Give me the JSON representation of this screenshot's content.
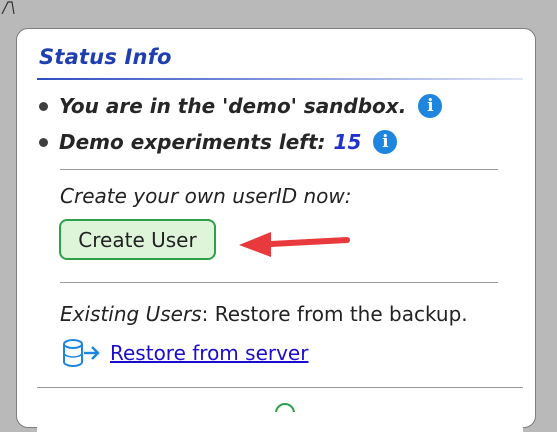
{
  "panel": {
    "title": "Status Info",
    "sandbox_line": "You are in the 'demo' sandbox.",
    "experiments_label": "Demo experiments left:",
    "experiments_count": "15",
    "info_icon_glyph": "i",
    "create_prompt": "Create your own userID now:",
    "create_button_label": "Create User",
    "existing_users_label": "Existing Users",
    "existing_users_text": ": Restore from the backup.",
    "restore_link_label": "Restore from server",
    "icons": [
      "info-icon",
      "database-restore-icon",
      "red-arrow-icon"
    ],
    "colors": {
      "title": "#1f3fb0",
      "info_icon": "#1e86de",
      "count": "#2233cc",
      "button_bg": "#dff5da",
      "button_border": "#2fa04a",
      "arrow": "#e8393d",
      "link": "#1a0dcc"
    }
  }
}
